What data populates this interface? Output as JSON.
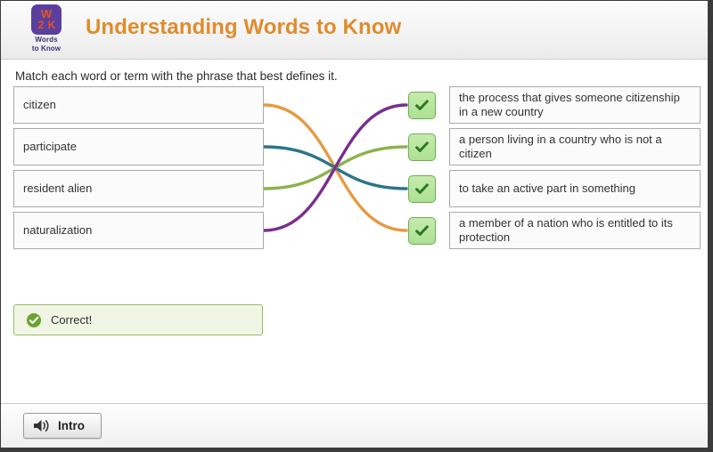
{
  "header": {
    "title": "Understanding Words to Know",
    "logo": {
      "mark_text": "W2K",
      "caption_line1": "Words",
      "caption_line2": "to Know",
      "mark_bg": "#5b3f9e",
      "mark_fg": "#e8541c"
    },
    "title_color": "#e08b2d"
  },
  "instruction": "Match each word or term with the phrase that best defines it.",
  "match": {
    "terms": [
      {
        "label": "citizen",
        "color": "#e59b42"
      },
      {
        "label": "participate",
        "color": "#2c758a"
      },
      {
        "label": "resident alien",
        "color": "#8cb24f"
      },
      {
        "label": "naturalization",
        "color": "#7a2d8f"
      }
    ],
    "definitions": [
      {
        "label": "the process that gives someone citizenship in a new country"
      },
      {
        "label": "a person living in a country who is not a citizen"
      },
      {
        "label": "to take an active part in something"
      },
      {
        "label": "a member of a nation who is entitled to its protection"
      }
    ],
    "badges": [
      {
        "state": "correct",
        "glyph": "check"
      },
      {
        "state": "correct",
        "glyph": "check"
      },
      {
        "state": "correct",
        "glyph": "check"
      },
      {
        "state": "correct",
        "glyph": "check"
      }
    ],
    "connections": [
      {
        "from_term": 0,
        "to_definition": 3,
        "color": "#e59b42"
      },
      {
        "from_term": 1,
        "to_definition": 2,
        "color": "#2c758a"
      },
      {
        "from_term": 2,
        "to_definition": 1,
        "color": "#8cb24f"
      },
      {
        "from_term": 3,
        "to_definition": 0,
        "color": "#7a2d8f"
      }
    ]
  },
  "feedback": {
    "text": "Correct!",
    "icon": "check-circle-icon",
    "bg_color": "#f1f6e4",
    "border_color": "#9cb86a",
    "icon_color": "#6aa32e"
  },
  "footer": {
    "intro_button_label": "Intro",
    "intro_button_icon": "speaker-icon"
  }
}
